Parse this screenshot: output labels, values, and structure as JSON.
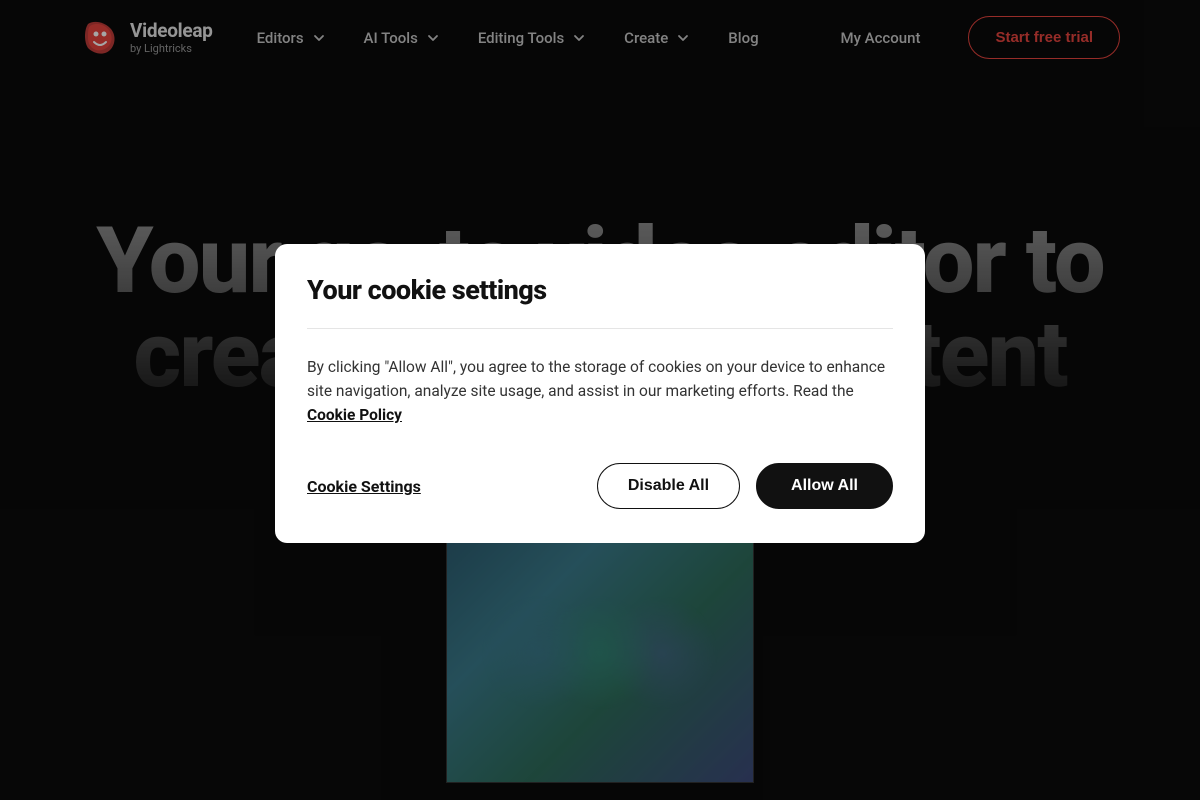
{
  "brand": {
    "title": "Videoleap",
    "subtitle": "by Lightricks"
  },
  "nav": {
    "items": [
      {
        "label": "Editors"
      },
      {
        "label": "AI Tools"
      },
      {
        "label": "Editing Tools"
      },
      {
        "label": "Create"
      },
      {
        "label": "Blog"
      }
    ],
    "account": "My Account",
    "cta": "Start free trial"
  },
  "hero": {
    "line1": "Your go-to video editor to",
    "line2": "create amazing content"
  },
  "modal": {
    "title": "Your cookie settings",
    "body_prefix": "By clicking \"Allow All\", you agree to the storage of cookies on your device to enhance site navigation, analyze site usage, and assist in our marketing efforts. Read the ",
    "policy_link": "Cookie Policy",
    "settings": "Cookie Settings",
    "disable": "Disable All",
    "allow": "Allow All"
  }
}
